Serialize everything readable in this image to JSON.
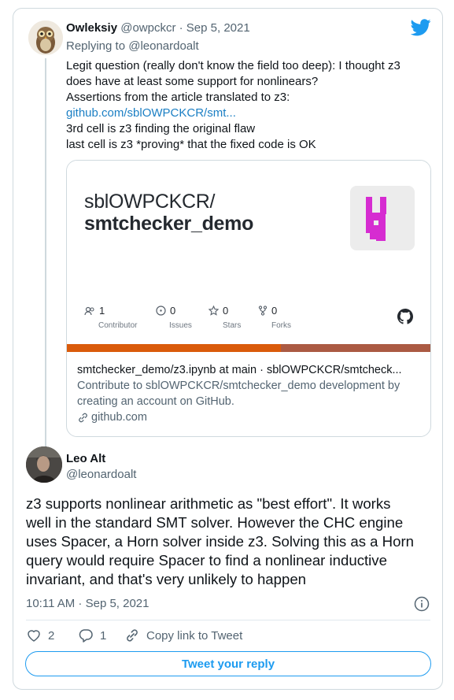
{
  "colors": {
    "accent": "#1d9bf0",
    "link": "#1b7fc4",
    "muted": "#536471",
    "lang_primary": "#da5b0b",
    "lang_secondary": "#ab5a43",
    "repo_logo": "#d62cd1"
  },
  "tweet1": {
    "author_name": "Owleksiy",
    "author_handle_date": "@owpckcr · Sep 5, 2021",
    "replying_to": "Replying to @leonardoalt",
    "lines": [
      "Legit question (really don't know the field too deep): I thought z3",
      "does have at least some support for nonlinears?",
      "Assertions from the article translated to z3:"
    ],
    "link": "github.com/sblOWPCKCR/smt...",
    "lines_after": [
      "3rd cell is z3 finding the original flaw",
      "last cell is z3 *proving* that the fixed code is OK"
    ]
  },
  "link_card": {
    "repo_owner": "sblOWPCKCR/",
    "repo_name": "smtchecker_demo",
    "stats": [
      {
        "value": "1",
        "label": "Contributor",
        "icon": "people-icon"
      },
      {
        "value": "0",
        "label": "Issues",
        "icon": "issue-icon"
      },
      {
        "value": "0",
        "label": "Stars",
        "icon": "star-icon"
      },
      {
        "value": "0",
        "label": "Forks",
        "icon": "fork-icon"
      }
    ],
    "title": "smtchecker_demo/z3.ipynb at main · sblOWPCKCR/smtcheck...",
    "description_lines": [
      "Contribute to sblOWPCKCR/smtchecker_demo development by",
      "creating an account on GitHub."
    ],
    "domain": "github.com"
  },
  "tweet2": {
    "author_name": "Leo Alt",
    "author_handle": "@leonardoalt",
    "lines": [
      "z3 supports nonlinear arithmetic as \"best effort\". It works",
      "well in the standard SMT solver. However the CHC engine",
      "uses Spacer, a Horn solver inside z3. Solving this as a Horn",
      "query would require Spacer to find a nonlinear inductive",
      "invariant, and that's very unlikely to happen"
    ],
    "timestamp": "10:11 AM · Sep 5, 2021",
    "likes": "2",
    "replies": "1",
    "copy_link": "Copy link to Tweet",
    "reply_button": "Tweet your reply"
  }
}
